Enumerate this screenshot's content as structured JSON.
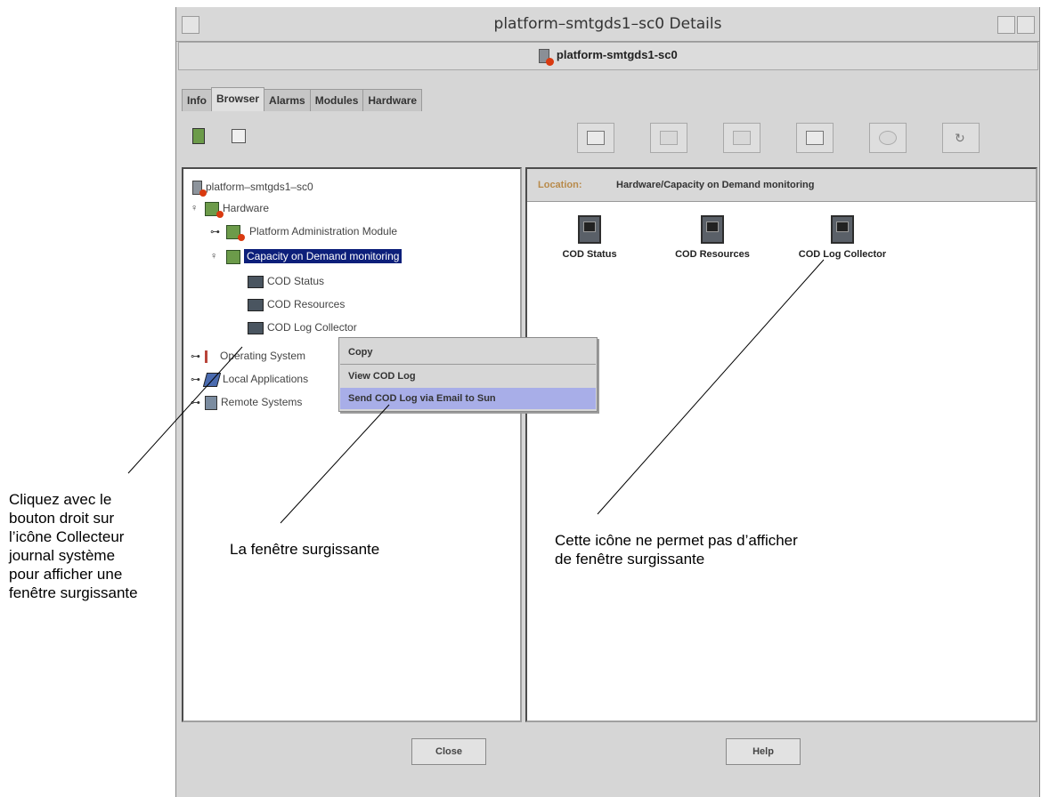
{
  "window": {
    "title": "platform–smtgds1–sc0 Details",
    "host": "platform-smtgds1-sc0"
  },
  "tabs": [
    "Info",
    "Browser",
    "Alarms",
    "Modules",
    "Hardware"
  ],
  "active_tab": "Browser",
  "tree": {
    "root": "platform–smtgds1–sc0",
    "hardware": "Hardware",
    "platform_admin_module": "Platform Administration Module",
    "cod_monitoring": "Capacity on Demand monitoring",
    "cod_status": "COD Status",
    "cod_resources": "COD Resources",
    "cod_log_collector": "COD Log Collector",
    "operating_system": "Operating System",
    "local_applications": "Local Applications",
    "remote_systems": "Remote Systems"
  },
  "location": {
    "label": "Location:",
    "value": "Hardware/Capacity on Demand monitoring"
  },
  "content_icons": [
    "COD Status",
    "COD Resources",
    "COD Log Collector"
  ],
  "context_menu": [
    "Copy",
    "View COD Log",
    "Send COD Log via Email to Sun"
  ],
  "buttons": {
    "close": "Close",
    "help": "Help"
  },
  "callouts": {
    "right_click": [
      "Cliquez avec le",
      "bouton droit sur",
      "l’icône Collecteur",
      "journal système",
      "pour afficher une",
      "fenêtre surgissante"
    ],
    "popup": "La fenêtre surgissante",
    "no_popup": [
      "Cette icône ne permet pas d’afficher",
      "de fenêtre surgissante"
    ]
  }
}
